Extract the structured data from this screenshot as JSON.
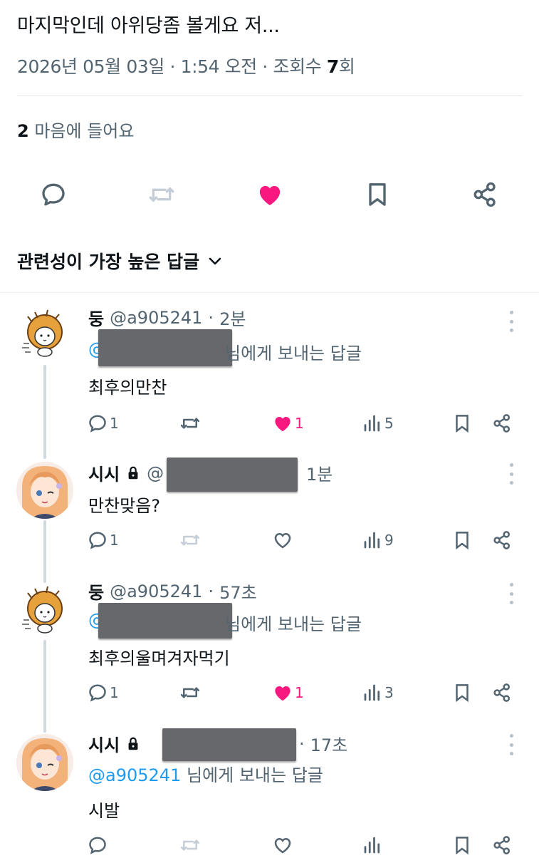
{
  "tweet": {
    "text": "마지막인데 아위당좀 볼게요 저...",
    "date": "2026년 05월 03일",
    "time": "1:54 오전",
    "views_label": "조회수",
    "views_count": "7",
    "views_suffix": "회",
    "likes_count": "2",
    "likes_label": "마음에 들어요",
    "colors": {
      "like": "#f91880",
      "link": "#1d9bf0",
      "muted": "#536471"
    },
    "icons": [
      "reply-icon",
      "retweet-icon",
      "heart-filled-icon",
      "bookmark-icon",
      "share-icon"
    ]
  },
  "sort": {
    "label": "관련성이 가장 높은 답글",
    "icon": "chevron-down-icon"
  },
  "replies": [
    {
      "name": "둥",
      "handle": "@a905241",
      "time": "2분",
      "reply_to_prefix": "@",
      "reply_to_suffix": "님에게 보내는 답글",
      "text": "최후의만찬",
      "replies": "1",
      "likes": "1",
      "views": "5",
      "liked": true
    },
    {
      "name": "시시",
      "handle_prefix": "@",
      "time": "1분",
      "text": "만찬맞음?",
      "replies": "1",
      "views": "9",
      "liked": false
    },
    {
      "name": "둥",
      "handle": "@a905241",
      "time": "57초",
      "reply_to_prefix": "@",
      "reply_to_suffix": "님에게 보내는 답글",
      "text": "최후의울며겨자먹기",
      "replies": "1",
      "likes": "1",
      "views": "3",
      "liked": true
    },
    {
      "name": "시시",
      "time": "17초",
      "reply_to": "@a905241",
      "reply_to_suffix": "님에게 보내는 답글",
      "text": "시발",
      "liked": false
    }
  ]
}
